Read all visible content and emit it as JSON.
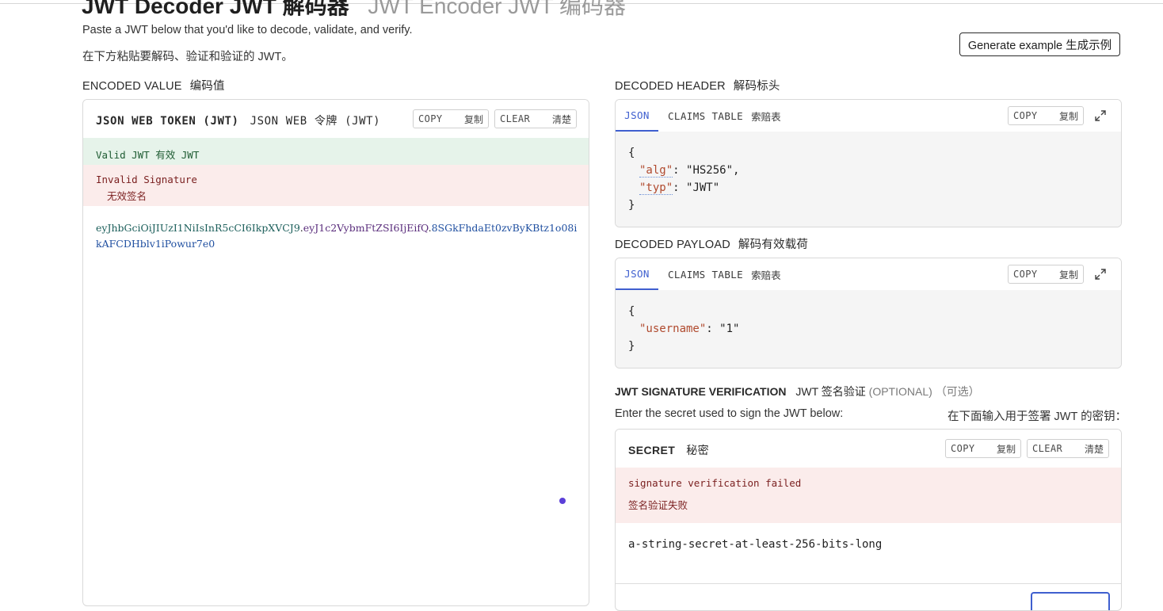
{
  "page": {
    "title_decoder": "JWT Decoder  JWT 解码器",
    "title_encoder": "JWT Encoder  JWT 编码器",
    "intro_en": "Paste a JWT below that you'd like to decode, validate, and verify.",
    "intro_cn": "在下方粘贴要解码、验证和验证的 JWT。",
    "generate_btn": "Generate example  生成示例"
  },
  "encoded": {
    "label_en": "ENCODED VALUE",
    "label_cn": "编码值",
    "panel_title_en": "JSON WEB TOKEN (JWT)",
    "panel_title_cn": "JSON WEB 令牌 (JWT)",
    "copy_en": "COPY",
    "copy_cn": "复制",
    "clear_en": "CLEAR",
    "clear_cn": "清楚",
    "valid_text": "Valid JWT  有效 JWT",
    "invalid_en": "Invalid Signature",
    "invalid_cn": "无效签名",
    "token_header": "eyJhbGciOiJIUzI1NiIsInR5cCI6IkpXVCJ9",
    "token_payload": "eyJ1c2VybmFtZSI6IjEifQ",
    "token_signature": "8SGkFhdaEt0zvByKBtz1o08ikAFCDHblv1iPowur7e0"
  },
  "decoded_header": {
    "label_en": "DECODED HEADER",
    "label_cn": "解码标头",
    "tab_json": "JSON",
    "tab_claims_en": "CLAIMS TABLE",
    "tab_claims_cn": "索赔表",
    "copy_en": "COPY",
    "copy_cn": "复制",
    "json_open": "{",
    "json_close": "}",
    "k1": "\"alg\"",
    "v1": "\"HS256\",",
    "k2": "\"typ\"",
    "v2": "\"JWT\""
  },
  "decoded_payload": {
    "label_en": "DECODED PAYLOAD",
    "label_cn": "解码有效载荷",
    "tab_json": "JSON",
    "tab_claims_en": "CLAIMS TABLE",
    "tab_claims_cn": "索赔表",
    "copy_en": "COPY",
    "copy_cn": "复制",
    "json_open": "{",
    "json_close": "}",
    "k1": "\"username\"",
    "v1": "\"1\""
  },
  "signature": {
    "label_en": "JWT SIGNATURE VERIFICATION",
    "label_cn": "JWT 签名验证",
    "optional_en": "(OPTIONAL)",
    "optional_cn": "（可选）",
    "instruction_en": "Enter the secret used to sign the JWT below:",
    "instruction_cn": "在下面输入用于签署 JWT 的密钥：",
    "secret_title_en": "SECRET",
    "secret_title_cn": "秘密",
    "copy_en": "COPY",
    "copy_cn": "复制",
    "clear_en": "CLEAR",
    "clear_cn": "清楚",
    "fail_en": "signature verification failed",
    "fail_cn": "签名验证失败",
    "secret_value": "a-string-secret-at-least-256-bits-long"
  },
  "colors": {
    "accent_blue": "#3f5fcf",
    "valid_bg": "#e6f3ea",
    "invalid_bg": "#fbeceb",
    "token_header": "#1b5e5a",
    "token_payload": "#5a2d7c",
    "token_signature": "#1f4fa0"
  }
}
